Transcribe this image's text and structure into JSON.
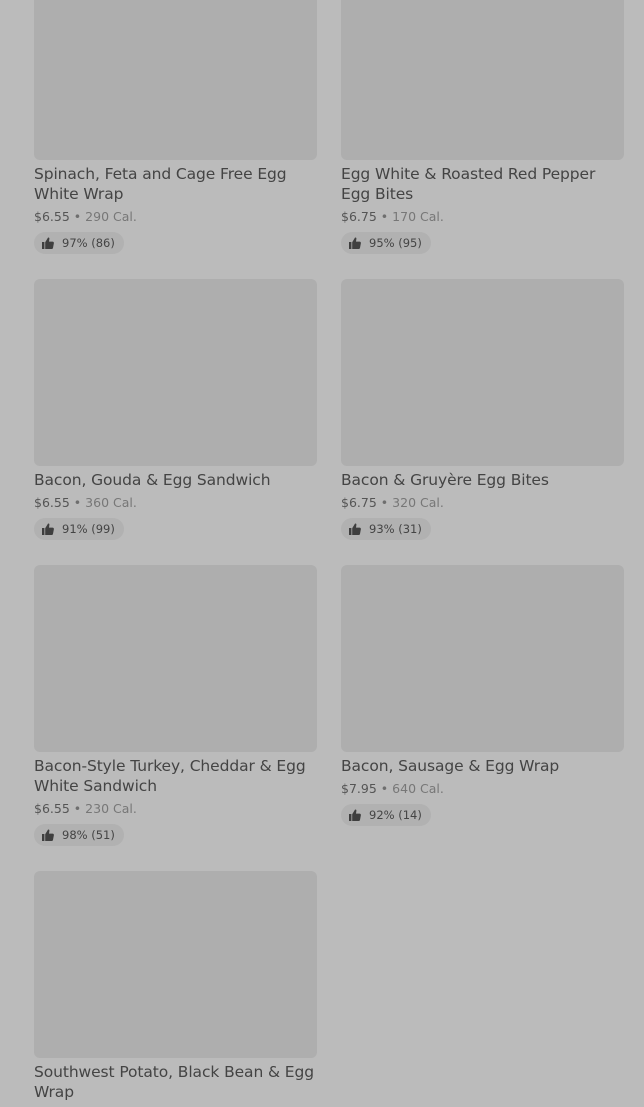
{
  "items": [
    {
      "name": "Spinach, Feta and Cage Free Egg White Wrap",
      "price": "$6.55",
      "calories": "290 Cal.",
      "rating": "97% (86)"
    },
    {
      "name": "Egg White & Roasted Red Pepper Egg Bites",
      "price": "$6.75",
      "calories": "170 Cal.",
      "rating": "95% (95)"
    },
    {
      "name": "Bacon, Gouda & Egg Sandwich",
      "price": "$6.55",
      "calories": "360 Cal.",
      "rating": "91% (99)"
    },
    {
      "name": "Bacon & Gruyère Egg Bites",
      "price": "$6.75",
      "calories": "320 Cal.",
      "rating": "93% (31)"
    },
    {
      "name": "Bacon-Style Turkey, Cheddar & Egg White Sandwich",
      "price": "$6.55",
      "calories": "230 Cal.",
      "rating": "98% (51)"
    },
    {
      "name": "Bacon, Sausage & Egg Wrap",
      "price": "$7.95",
      "calories": "640 Cal.",
      "rating": "92% (14)"
    },
    {
      "name": "Southwest Potato, Black Bean & Egg Wrap"
    }
  ],
  "separator": "•",
  "icons": {
    "thumbs_up": "thumbs-up-icon"
  },
  "colors": {
    "background": "#bbbbbb",
    "thumbnail": "#aeaeae",
    "rating_pill": "#b1b1b1",
    "text": "#444444"
  }
}
